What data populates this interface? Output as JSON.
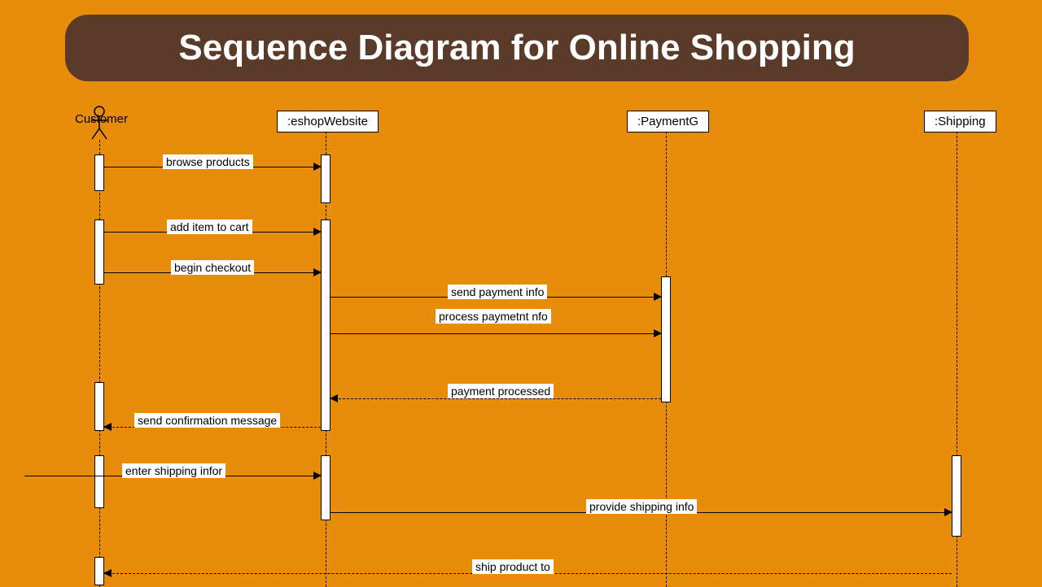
{
  "title": "Sequence Diagram for Online Shopping",
  "participants": {
    "customer": "Customer",
    "eshop": ":eshopWebsite",
    "payment": ":PaymentG",
    "shipping": ":Shipping"
  },
  "messages": {
    "m1": "browse products",
    "m2": "add item to cart",
    "m3": "begin checkout",
    "m4": "send payment info",
    "m5": "process paymetnt nfo",
    "m6": "payment processed",
    "m7": "send confirmation message",
    "m8": "enter shipping infor",
    "m9": "provide shipping info",
    "m10": "ship product to"
  }
}
